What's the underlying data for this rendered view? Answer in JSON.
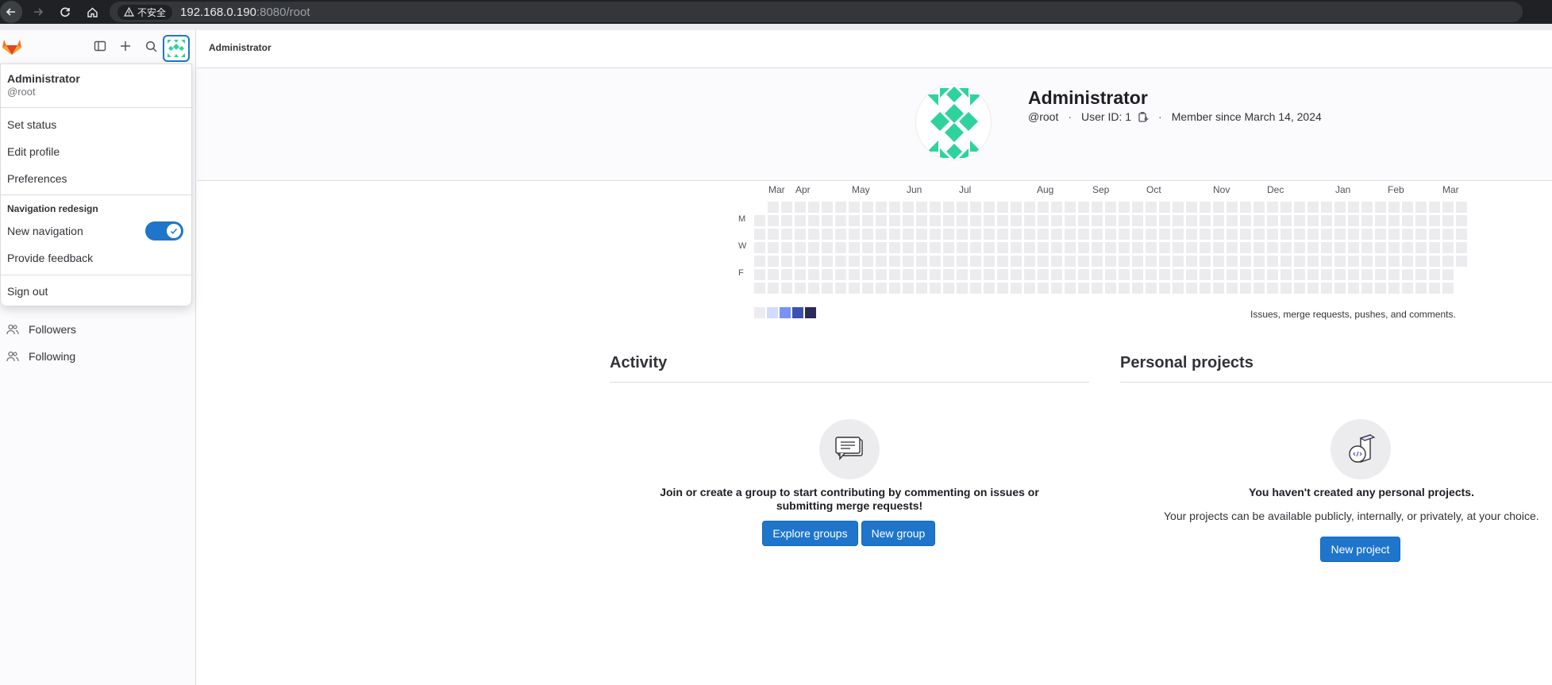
{
  "browser": {
    "security_label": "不安全",
    "url_host": "192.168.0.190",
    "url_path": ":8080/root"
  },
  "sidebar": {
    "items": [
      {
        "label": "Followers",
        "icon": "users-icon"
      },
      {
        "label": "Following",
        "icon": "users-icon"
      }
    ]
  },
  "user_menu": {
    "name": "Administrator",
    "username": "@root",
    "set_status": "Set status",
    "edit_profile": "Edit profile",
    "preferences": "Preferences",
    "section_heading": "Navigation redesign",
    "new_navigation": "New navigation",
    "new_navigation_enabled": true,
    "provide_feedback": "Provide feedback",
    "sign_out": "Sign out"
  },
  "breadcrumb": "Administrator",
  "profile": {
    "name": "Administrator",
    "username": "@root",
    "user_id": "User ID: 1",
    "member_since": "Member since March 14, 2024"
  },
  "calendar": {
    "months": [
      "Mar",
      "Apr",
      "May",
      "Jun",
      "Jul",
      "Aug",
      "Sep",
      "Oct",
      "Nov",
      "Dec",
      "Jan",
      "Feb",
      "Mar"
    ],
    "day_labels": [
      "M",
      "W",
      "F"
    ],
    "caption": "Issues, merge requests, pushes, and comments.",
    "legend_colors": [
      "#ececef",
      "#d2dcff",
      "#7992f5",
      "#3f51ae",
      "#2a2b59"
    ],
    "contributions": 0
  },
  "activity": {
    "title": "Activity",
    "empty_text": "Join or create a group to start contributing by commenting on issues or submitting merge requests!",
    "explore_groups": "Explore groups",
    "new_group": "New group"
  },
  "projects": {
    "title": "Personal projects",
    "empty_title": "You haven't created any personal projects.",
    "empty_sub": "Your projects can be available publicly, internally, or privately, at your choice.",
    "new_project": "New project"
  },
  "colors": {
    "accent": "#1f75cb",
    "identicon": "#2ed39c"
  }
}
